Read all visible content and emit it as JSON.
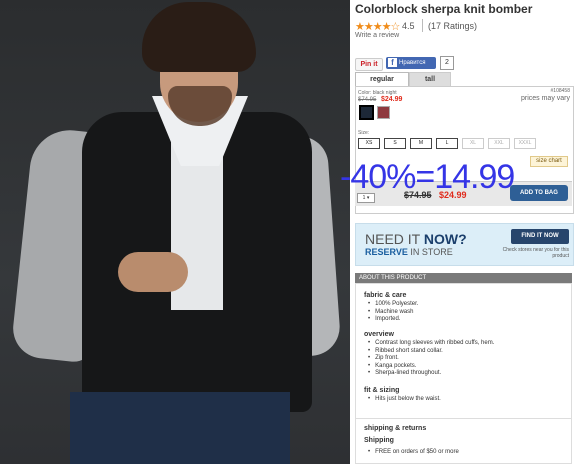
{
  "product": {
    "title": "Colorblock sherpa knit bomber",
    "stars": "★★★★☆",
    "rating": "4.5",
    "ratings_count": "(17 Ratings)",
    "write_review": "Write a review"
  },
  "social": {
    "pinit": "Pin it",
    "fb_label": "Нравится",
    "fb_count": "2"
  },
  "tabs": [
    "regular",
    "tall"
  ],
  "options": {
    "color_label": "Color: black night",
    "item_number": "#108458",
    "prices_vary": "prices may vary",
    "old_price": "$74.95",
    "new_price": "$24.99",
    "swatch_colors": [
      "#1d2837",
      "#8e3a3f"
    ],
    "size_label": "Size:",
    "sizes": [
      "XS",
      "S",
      "M",
      "L",
      "XL",
      "XXL",
      "XXXL"
    ],
    "size_chart": "size chart"
  },
  "cart": {
    "qty": "1 ▾",
    "old_price": "$74.95",
    "new_price": "$24.99",
    "add_label": "ADD TO BAG"
  },
  "overlay_text": "-40%=14.99",
  "store": {
    "need_it": "NEED IT ",
    "now": "NOW?",
    "reserve": "RESERVE",
    "in_store": " IN STORE",
    "find_label": "FIND IT NOW",
    "check_text": "Check stores near you for this product"
  },
  "about": {
    "header": "ABOUT THIS PRODUCT",
    "fabric_title": "fabric & care",
    "fabric_items": [
      "100% Polyester.",
      "Machine wash",
      "Imported."
    ],
    "overview_title": "overview",
    "overview_items": [
      "Contrast long sleeves with ribbed cuffs, hem.",
      "Ribbed short stand collar.",
      "Zip front.",
      "Kanga pockets.",
      "Sherpa-lined throughout."
    ],
    "fit_title": "fit & sizing",
    "fit_items": [
      "Hits just below the waist."
    ]
  },
  "shipping": {
    "title": "shipping & returns",
    "subtitle": "Shipping",
    "item": "FREE on orders of $50 or more"
  }
}
